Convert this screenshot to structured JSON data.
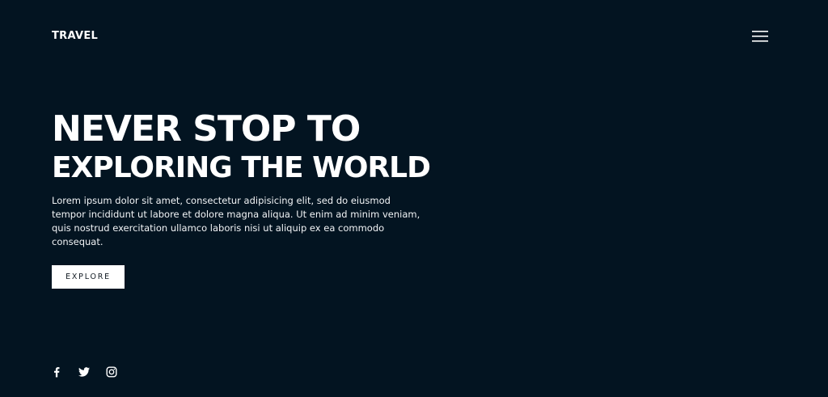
{
  "header": {
    "logo": "TRAVEL",
    "menu_icon": "hamburger-menu-icon"
  },
  "hero": {
    "title_line1": "NEVER STOP TO",
    "title_line2": "EXPLORING THE WORLD",
    "description": "Lorem ipsum dolor sit amet, consectetur adipisicing elit, sed do eiusmod tempor incididunt ut labore et dolore magna aliqua. Ut enim ad minim veniam, quis nostrud exercitation ullamco laboris nisi ut aliquip ex ea commodo consequat.",
    "cta_label": "EXPLORE"
  },
  "social": {
    "icons": [
      "facebook-icon",
      "twitter-icon",
      "instagram-icon"
    ]
  },
  "colors": {
    "background": "#031421",
    "text": "#ffffff",
    "button_bg": "#ffffff",
    "button_text": "#111a22"
  }
}
